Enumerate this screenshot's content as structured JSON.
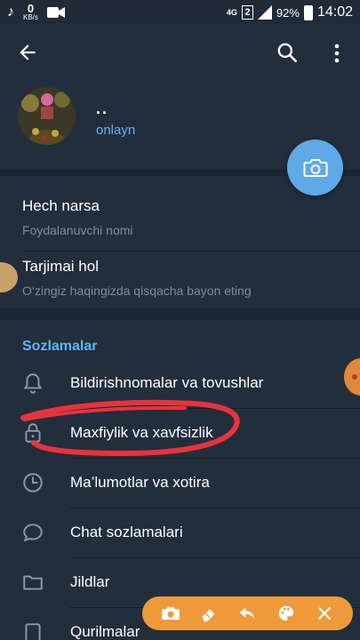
{
  "status_bar": {
    "kb_value": "0",
    "kb_unit": "KB/s",
    "network": "4G",
    "sim": "2",
    "battery": "92%",
    "time": "14:02",
    "icons": [
      "music-note-icon",
      "video-icon",
      "signal-icon",
      "battery-icon"
    ]
  },
  "app_bar": {
    "icons": [
      "back-arrow-icon",
      "search-icon",
      "more-vert-icon"
    ]
  },
  "profile": {
    "name": "..",
    "status": "onlayn"
  },
  "info": {
    "username_value": "Hech narsa",
    "username_label": "Foydalanuvchi nomi",
    "bio_title": "Tarjimai hol",
    "bio_hint": "O‘zingiz haqingizda qisqacha bayon eting"
  },
  "settings": {
    "title": "Sozlamalar",
    "items": [
      {
        "label": "Bildirishnomalar va tovushlar",
        "icon": "bell-icon"
      },
      {
        "label": "Maxfiylik va xavfsizlik",
        "icon": "lock-icon"
      },
      {
        "label": "Ma’lumotlar va xotira",
        "icon": "clock-icon"
      },
      {
        "label": "Chat sozlamalari",
        "icon": "chat-bubble-icon"
      },
      {
        "label": "Jildlar",
        "icon": "folder-icon"
      },
      {
        "label": "Qurilmalar",
        "icon": "devices-icon"
      }
    ]
  },
  "colors": {
    "background": "#1d2733",
    "card": "#232e3c",
    "accent": "#5eb5f7",
    "fab": "#5ea9e6",
    "annotation": "#e8333a",
    "toolbar": "#ef9a3a"
  },
  "toolbar": {
    "icons": [
      "camera-icon",
      "eraser-icon",
      "undo-icon",
      "palette-icon",
      "close-icon"
    ]
  }
}
